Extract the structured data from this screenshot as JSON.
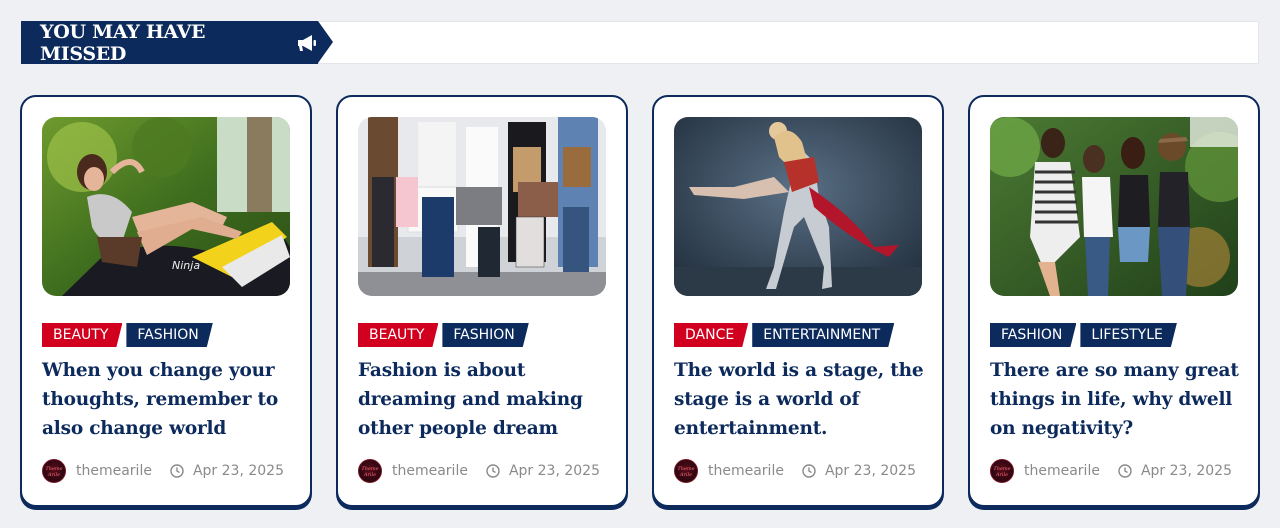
{
  "section": {
    "title": "YOU MAY HAVE MISSED",
    "icon": "megaphone-icon"
  },
  "colors": {
    "navy": "#0c2a5c",
    "red": "#d2001f",
    "background": "#eff0f3"
  },
  "cards": [
    {
      "image_alt": "Woman lounging on a motorcycle",
      "tags": [
        {
          "label": "BEAUTY",
          "color": "red"
        },
        {
          "label": "FASHION",
          "color": "navy"
        }
      ],
      "title": "When you change your thoughts, remember to also change world",
      "author": "themearile",
      "date": "Apr 23, 2025"
    },
    {
      "image_alt": "People holding shopping bags",
      "tags": [
        {
          "label": "BEAUTY",
          "color": "red"
        },
        {
          "label": "FASHION",
          "color": "navy"
        }
      ],
      "title": "Fashion is about dreaming and making other people dream",
      "author": "themearile",
      "date": "Apr 23, 2025"
    },
    {
      "image_alt": "Two dancers performing",
      "tags": [
        {
          "label": "DANCE",
          "color": "red"
        },
        {
          "label": "ENTERTAINMENT",
          "color": "navy"
        }
      ],
      "title": "The world is a stage, the stage is a world of entertainment.",
      "author": "themearile",
      "date": "Apr 23, 2025"
    },
    {
      "image_alt": "Four friends smiling in a garden",
      "tags": [
        {
          "label": "FASHION",
          "color": "navy"
        },
        {
          "label": "LIFESTYLE",
          "color": "navy"
        }
      ],
      "title": "There are so many great things in life, why dwell on negativity?",
      "author": "themearile",
      "date": "Apr 23, 2025"
    }
  ],
  "avatar_text": "Theme Arile"
}
